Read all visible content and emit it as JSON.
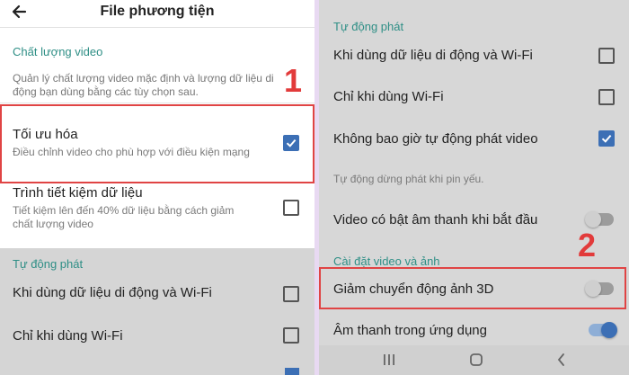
{
  "left": {
    "title": "File phương tiện",
    "quality_section": "Chất lượng video",
    "quality_desc_1": "Quản lý chất lượng video mặc định và lượng dữ liệu di",
    "quality_desc_2": "động bạn dùng bằng các tùy chọn sau.",
    "optimize_title": "Tối ưu hóa",
    "optimize_sub": "Điều chỉnh video cho phù hợp với điều kiện mạng",
    "optimize_checked": true,
    "datasaver_title": "Trình tiết kiệm dữ liệu",
    "datasaver_sub_1": "Tiết kiệm lên đến 40% dữ liệu bằng cách giảm",
    "datasaver_sub_2": "chất lượng video",
    "datasaver_checked": false,
    "autoplay_section": "Tự động phát",
    "autoplay_mobile": "Khi dùng dữ liệu di động và Wi-Fi",
    "autoplay_mobile_checked": false,
    "autoplay_wifi": "Chỉ khi dùng Wi-Fi",
    "autoplay_wifi_checked": false,
    "marker": "1"
  },
  "right": {
    "autoplay_section": "Tự động phát",
    "autoplay_mobile": "Khi dùng dữ liệu di động và Wi-Fi",
    "autoplay_mobile_checked": false,
    "autoplay_wifi": "Chỉ khi dùng Wi-Fi",
    "autoplay_wifi_checked": false,
    "autoplay_never": "Không bao giờ tự động phát video",
    "autoplay_never_checked": true,
    "battery_note": "Tự động dừng phát khi pin yếu.",
    "sound_on_start": "Video có bật âm thanh khi bắt đầu",
    "sound_on_start_on": false,
    "photo_section": "Cài đặt video và ảnh",
    "reduce_3d": "Giảm chuyển động ảnh 3D",
    "reduce_3d_on": false,
    "in_app_sound": "Âm thanh trong ứng dụng",
    "in_app_sound_on": true,
    "marker": "2"
  },
  "colors": {
    "accent": "#3c6fb5",
    "section": "#2f8f86",
    "highlight": "#e04444"
  },
  "icons": {
    "back": "arrow-left-icon",
    "check": "check-icon",
    "nav_recent": "recent-apps-icon",
    "nav_home": "home-icon",
    "nav_back": "chevron-left-icon"
  }
}
